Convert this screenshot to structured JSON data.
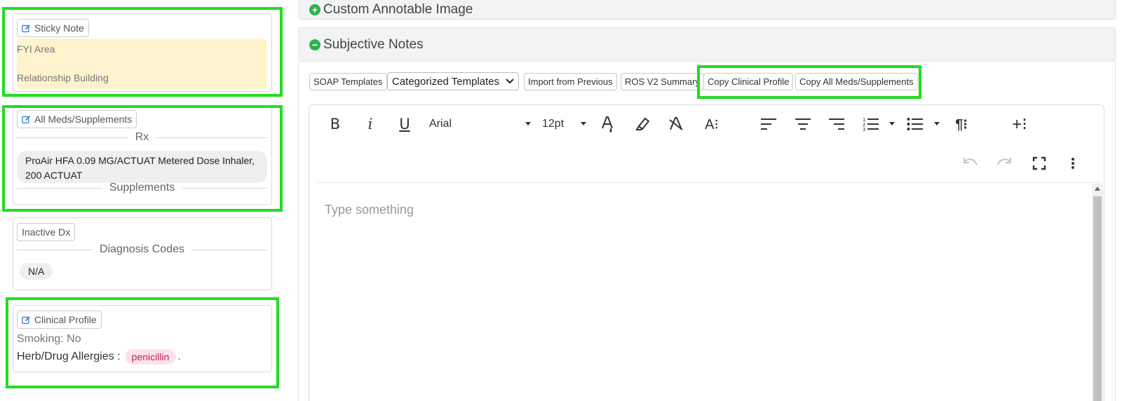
{
  "sticky_note": {
    "button_label": "Sticky Note",
    "fyi_area": "FYI Area",
    "relationship_building": "Relationship Building"
  },
  "meds": {
    "button_label": "All Meds/Supplements",
    "rx_heading": "Rx",
    "rx_items": [
      "ProAir HFA 0.09 MG/ACTUAT Metered Dose Inhaler, 200 ACTUAT"
    ],
    "supplements_heading": "Supplements"
  },
  "inactive_dx": {
    "button_label": "Inactive Dx",
    "diagnosis_heading": "Diagnosis Codes",
    "value": "N/A"
  },
  "clinical_profile": {
    "button_label": "Clinical Profile",
    "smoking": "Smoking: No",
    "allergies_label": "Herb/Drug Allergies :",
    "allergy_tag": "penicillin",
    "trailing": "."
  },
  "accordions": {
    "custom_image": "Custom Annotable Image",
    "subjective": "Subjective Notes"
  },
  "toolbar": {
    "soap_templates": "SOAP Templates",
    "categorized_templates": "Categorized Templates",
    "import_previous": "Import from Previous",
    "ros_summary": "ROS V2 Summary",
    "copy_clinical": "Copy Clinical Profile",
    "copy_meds": "Copy All Meds/Supplements"
  },
  "editor": {
    "font_family": "Arial",
    "font_size": "12pt",
    "placeholder": "Type something",
    "icons": [
      "bold-icon",
      "italic-icon",
      "underline-icon",
      "font-color-icon",
      "highlight-icon",
      "clear-format-icon",
      "font-size-icon",
      "align-left-icon",
      "align-center-icon",
      "align-right-icon",
      "ordered-list-icon",
      "unordered-list-icon",
      "paragraph-icon",
      "insert-icon",
      "undo-icon",
      "redo-icon",
      "fullscreen-icon",
      "more-icon"
    ]
  },
  "colors": {
    "highlight": "#22dd22",
    "sticky_bg": "#fff3cd",
    "allergy_tag_bg": "#fde2ec",
    "accordion_icon": "#2cb34a"
  }
}
